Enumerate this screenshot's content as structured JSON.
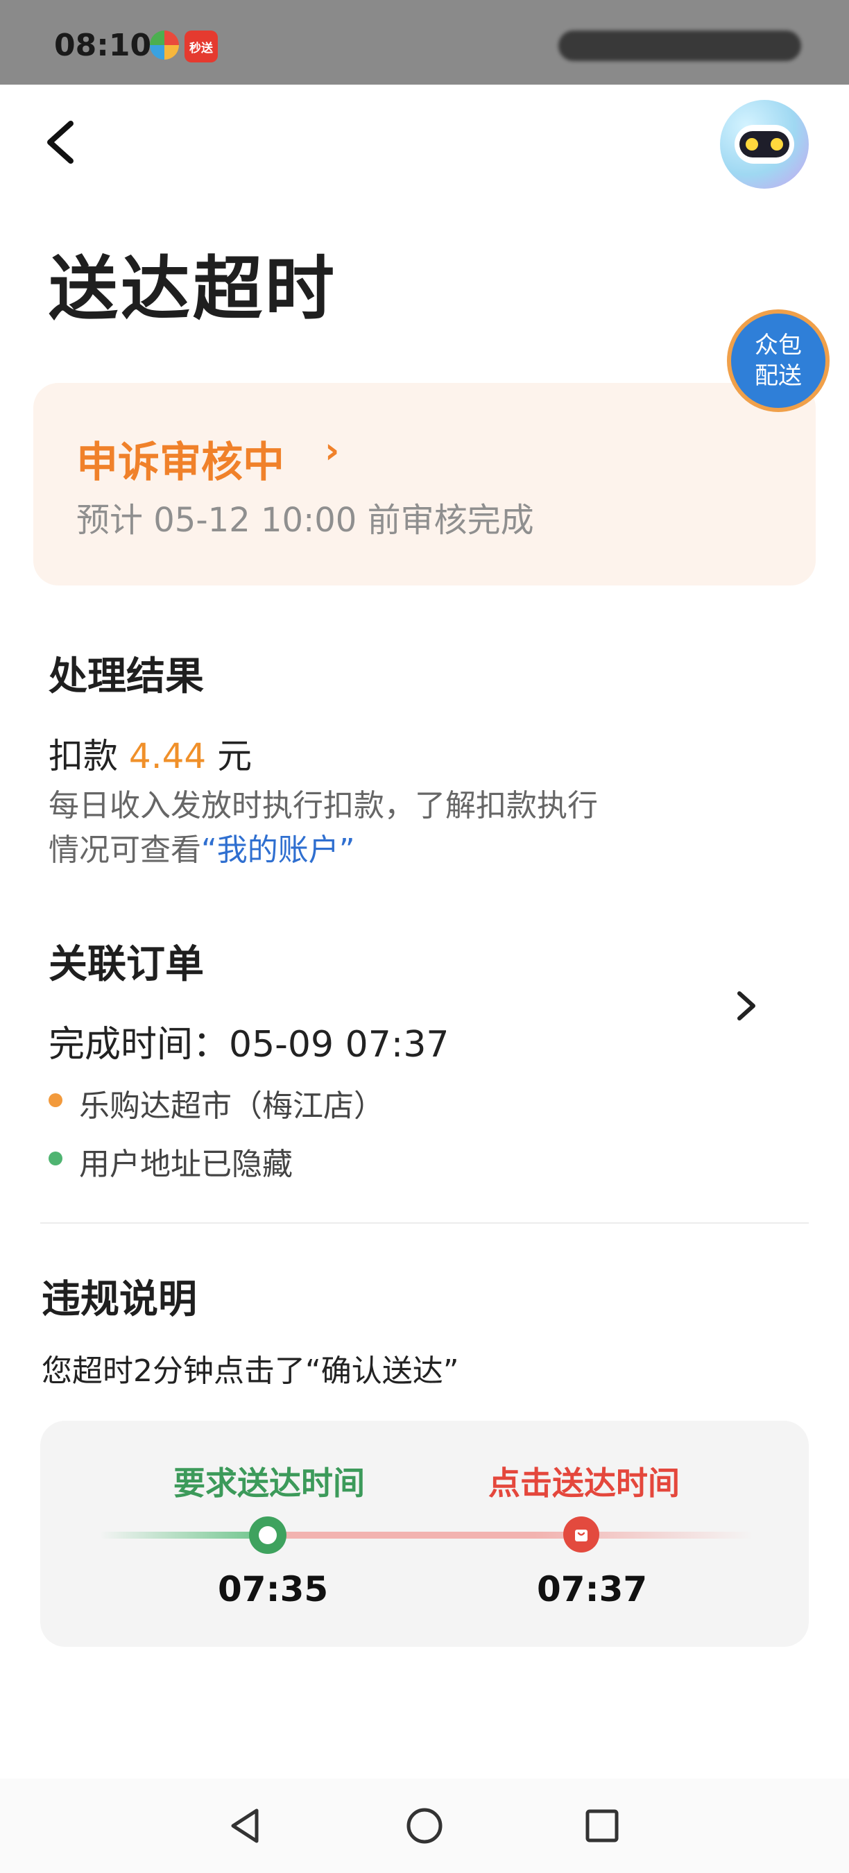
{
  "status_bar": {
    "time": "08:10",
    "app_icon_1": "colorful-app-icon",
    "app_icon_2_text": "秒送"
  },
  "header": {
    "back_icon": "chevron-left-icon",
    "assistant_icon": "robot-avatar-icon"
  },
  "page": {
    "title": "送达超时",
    "crowd_badge_line1": "众包",
    "crowd_badge_line2": "配送"
  },
  "appeal": {
    "status": "申诉审核中",
    "chevron": "›",
    "eta": "预计 05-12 10:00 前审核完成"
  },
  "result": {
    "title": "处理结果",
    "deduction_prefix": "扣款",
    "deduction_amount": "4.44",
    "deduction_unit": "元",
    "note_line1": "每日收入发放时执行扣款，了解扣款执行",
    "note_line2_prefix": "情况可查看",
    "note_link": "“我的账户”"
  },
  "order": {
    "title": "关联订单",
    "completed_time": "完成时间：05-09 07:37",
    "store": "乐购达超市（梅江店）",
    "address": "用户地址已隐藏"
  },
  "violation": {
    "title": "违规说明",
    "description": "您超时2分钟点击了“确认送达”",
    "required_label": "要求送达时间",
    "clicked_label": "点击送达时间",
    "required_time": "07:35",
    "clicked_time": "07:37"
  },
  "colors": {
    "accent_orange": "#f0812a",
    "link_blue": "#2f6fd0",
    "green": "#3ea25e",
    "red": "#e34a3e"
  },
  "nav": {
    "back": "nav-back-icon",
    "home": "nav-home-icon",
    "recents": "nav-recents-icon"
  }
}
